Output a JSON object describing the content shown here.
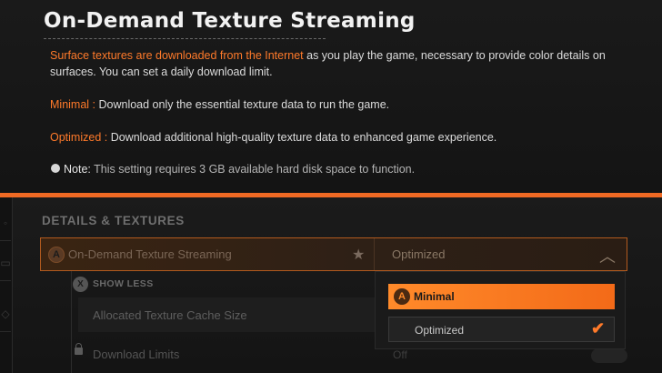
{
  "info": {
    "title": "On-Demand Texture Streaming",
    "intro_highlight": "Surface textures are downloaded from the Internet",
    "intro_rest_line1": " as you play the game, necessary to provide color details on",
    "intro_line2": "surfaces. You can set a daily download limit.",
    "minimal_term": "Minimal :",
    "minimal_desc": " Download only the essential texture data to run the game.",
    "optimized_term": "Optimized :",
    "optimized_desc": " Download additional high-quality texture data to enhanced game experience.",
    "note_label": "Note:",
    "note_text": " This setting requires 3 GB available hard disk space to function."
  },
  "settings": {
    "section_heading": "DETAILS & TEXTURES",
    "setting_label": "On-Demand Texture Streaming",
    "setting_value": "Optimized",
    "button_glyph_a": "A",
    "button_glyph_x": "X",
    "show_less": "SHOW LESS",
    "cache_label": "Allocated Texture Cache Size",
    "download_limits": "Download Limits",
    "download_limits_value": "Off"
  },
  "dropdown": {
    "options": [
      {
        "label": "Minimal",
        "highlighted": true
      },
      {
        "label": "Optimized",
        "selected": true
      }
    ]
  },
  "colors": {
    "accent": "#f06a24",
    "highlight_text": "#ff7a2a"
  },
  "icons": {
    "star": "favorite-star-icon",
    "chevron": "chevron-up-icon",
    "check": "checkmark-icon",
    "lock": "lock-icon",
    "note": "info-dot-icon"
  }
}
